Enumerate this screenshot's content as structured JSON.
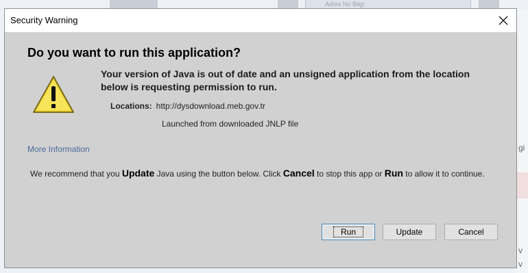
{
  "background": {
    "tab_text": "Adres No Bilgi",
    "right_glyphs": [
      "gi",
      "v",
      "v"
    ]
  },
  "dialog": {
    "title": "Security Warning",
    "close_glyph": "✕",
    "heading": "Do you want to run this application?",
    "message": "Your version of Java is out of date and an unsigned application from the location below is requesting permission to run.",
    "locations_label": "Locations:",
    "locations_value": "http://dysdownload.meb.gov.tr",
    "launched_text": "Launched from downloaded JNLP file",
    "more_info_link": "More Information",
    "recommend": {
      "part1": "We recommend that you ",
      "update_word": "Update",
      "part2": " Java using the button below. Click ",
      "cancel_word": "Cancel",
      "part3": " to stop this app or ",
      "run_word": "Run",
      "part4": " to allow it to continue."
    },
    "buttons": {
      "run": "Run",
      "update": "Update",
      "cancel": "Cancel"
    },
    "icon": "warning-triangle-icon"
  }
}
